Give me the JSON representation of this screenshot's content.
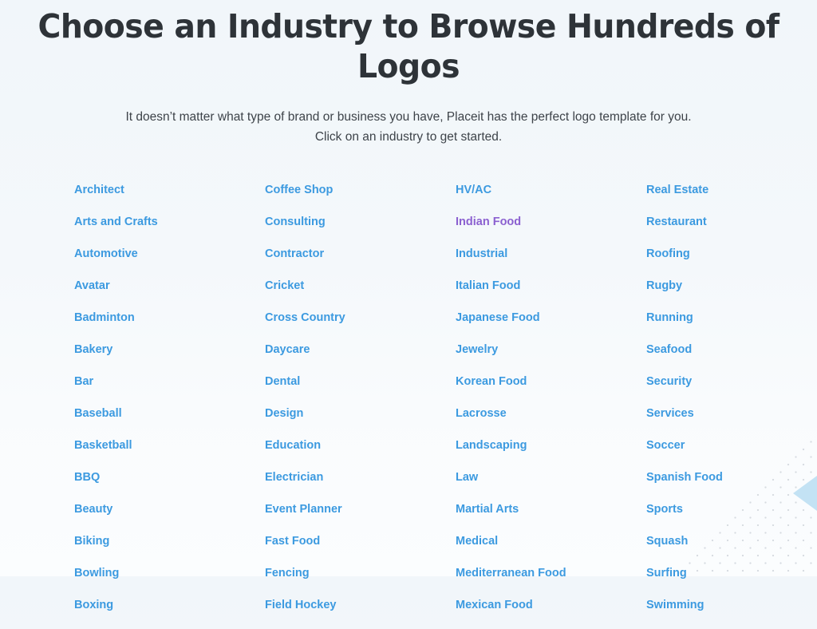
{
  "header": {
    "title": "Choose an Industry to Browse Hundreds of Logos",
    "subtitle_line1": "It doesn’t matter what type of brand or business you have, Placeit has the perfect logo template for you.",
    "subtitle_line2": "Click on an industry to get started."
  },
  "colors": {
    "link": "#3c9ae0",
    "link_visited": "#8b60d0",
    "heading": "#2e3338",
    "subtitle": "#3d4349",
    "background_top": "#f1f6fa",
    "background_bottom": "#fbfdfe",
    "decor_triangle": "#c3e2f4",
    "decor_dots": "#d8dce2"
  },
  "columns": [
    {
      "name": "industry-column-1",
      "items": [
        {
          "label": "Architect",
          "visited": false
        },
        {
          "label": "Arts and Crafts",
          "visited": false
        },
        {
          "label": "Automotive",
          "visited": false
        },
        {
          "label": "Avatar",
          "visited": false
        },
        {
          "label": "Badminton",
          "visited": false
        },
        {
          "label": "Bakery",
          "visited": false
        },
        {
          "label": "Bar",
          "visited": false
        },
        {
          "label": "Baseball",
          "visited": false
        },
        {
          "label": "Basketball",
          "visited": false
        },
        {
          "label": "BBQ",
          "visited": false
        },
        {
          "label": "Beauty",
          "visited": false
        },
        {
          "label": "Biking",
          "visited": false
        },
        {
          "label": "Bowling",
          "visited": false
        },
        {
          "label": "Boxing",
          "visited": false
        }
      ]
    },
    {
      "name": "industry-column-2",
      "items": [
        {
          "label": "Coffee Shop",
          "visited": false
        },
        {
          "label": "Consulting",
          "visited": false
        },
        {
          "label": "Contractor",
          "visited": false
        },
        {
          "label": "Cricket",
          "visited": false
        },
        {
          "label": "Cross Country",
          "visited": false
        },
        {
          "label": "Daycare",
          "visited": false
        },
        {
          "label": "Dental",
          "visited": false
        },
        {
          "label": "Design",
          "visited": false
        },
        {
          "label": "Education",
          "visited": false
        },
        {
          "label": "Electrician",
          "visited": false
        },
        {
          "label": "Event Planner",
          "visited": false
        },
        {
          "label": "Fast Food",
          "visited": false
        },
        {
          "label": "Fencing",
          "visited": false
        },
        {
          "label": "Field Hockey",
          "visited": false
        }
      ]
    },
    {
      "name": "industry-column-3",
      "items": [
        {
          "label": "HV/AC",
          "visited": false
        },
        {
          "label": "Indian Food",
          "visited": true
        },
        {
          "label": "Industrial",
          "visited": false
        },
        {
          "label": "Italian Food",
          "visited": false
        },
        {
          "label": "Japanese Food",
          "visited": false
        },
        {
          "label": "Jewelry",
          "visited": false
        },
        {
          "label": "Korean Food",
          "visited": false
        },
        {
          "label": "Lacrosse",
          "visited": false
        },
        {
          "label": "Landscaping",
          "visited": false
        },
        {
          "label": "Law",
          "visited": false
        },
        {
          "label": "Martial Arts",
          "visited": false
        },
        {
          "label": "Medical",
          "visited": false
        },
        {
          "label": "Mediterranean Food",
          "visited": false
        },
        {
          "label": "Mexican Food",
          "visited": false
        }
      ]
    },
    {
      "name": "industry-column-4",
      "items": [
        {
          "label": "Real Estate",
          "visited": false
        },
        {
          "label": "Restaurant",
          "visited": false
        },
        {
          "label": "Roofing",
          "visited": false
        },
        {
          "label": "Rugby",
          "visited": false
        },
        {
          "label": "Running",
          "visited": false
        },
        {
          "label": "Seafood",
          "visited": false
        },
        {
          "label": "Security",
          "visited": false
        },
        {
          "label": "Services",
          "visited": false
        },
        {
          "label": "Soccer",
          "visited": false
        },
        {
          "label": "Spanish Food",
          "visited": false
        },
        {
          "label": "Sports",
          "visited": false
        },
        {
          "label": "Squash",
          "visited": false
        },
        {
          "label": "Surfing",
          "visited": false
        },
        {
          "label": "Swimming",
          "visited": false
        }
      ]
    }
  ]
}
